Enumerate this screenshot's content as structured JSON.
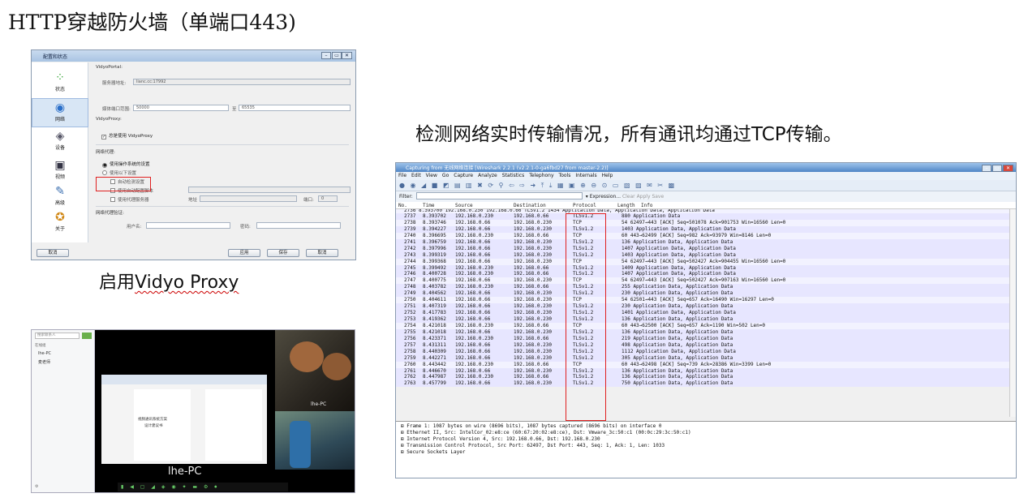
{
  "slide": {
    "title": "HTTP穿越防火墙（单端口443)",
    "caption_right": "检测网络实时传输情况，所有通讯均通过TCP传输。",
    "caption_proxy_prefix": "启用",
    "caption_proxy_word": "Vidyo Proxy"
  },
  "config_window": {
    "title": "配置和状态",
    "sidebar": [
      {
        "label": "状态",
        "icon": "status-icon"
      },
      {
        "label": "网络",
        "icon": "network-icon"
      },
      {
        "label": "设备",
        "icon": "device-icon"
      },
      {
        "label": "视频",
        "icon": "video-icon"
      },
      {
        "label": "高级",
        "icon": "advanced-icon"
      },
      {
        "label": "关于",
        "icon": "about-icon"
      }
    ],
    "vidyoportal_label": "VidyoPortal:",
    "portal_addr_label": "服务器地址:",
    "portal_addr_value": "lianc.cc:17992",
    "media_port_label": "媒体端口范围:",
    "media_port_from": "50000",
    "media_port_to_label": "至",
    "media_port_to": "65535",
    "vidyoproxy_label": "VidyoProxy:",
    "always_proxy": "总是使用 VidyoProxy",
    "web_proxy_label": "网络代理:",
    "use_system": "使用操作系统的设置",
    "use_following": "使用以下设置",
    "auto_detect": "自动检测设置",
    "use_auto_config": "使用自动配置脚本",
    "use_proxy_server": "使用代理服务器",
    "address_label": "地址",
    "port_label": "端口:",
    "port_value": "0",
    "proxy_auth_label": "网络代理验证:",
    "username_label": "用户名:",
    "password_label": "密码:",
    "btn_cancel_left": "取消",
    "btn_apply": "应用",
    "btn_save": "保存",
    "btn_cancel": "取消"
  },
  "wireshark": {
    "title": "Capturing from 无线网络连接  [Wireshark 2.2.1 (v2.2.1-0-ga6fbd27 from master-2.2)]",
    "menu": [
      "File",
      "Edit",
      "View",
      "Go",
      "Capture",
      "Analyze",
      "Statistics",
      "Telephony",
      "Tools",
      "Internals",
      "Help"
    ],
    "toolbar_icons": "● ◉ ◢ ■ ◩ ▤ ▥ ✖ ⟳ ⚲ ⇦ ⇨ ➜ ⤒ ⤓ ▦ ▣ ⊕ ⊖ ⊙ ▭ ▧ ▨ ✉ ✂ ▩",
    "filter_label": "Filter:",
    "filter_expression": "Expression...",
    "filter_clear": "Clear",
    "filter_apply": "Apply",
    "filter_save": "Save",
    "columns": {
      "no": "No.",
      "time": "Time",
      "source": "Source",
      "destination": "Destination",
      "protocol": "Protocol",
      "length": "Length",
      "info": "Info"
    },
    "partial_row": "2736 8.393700  192.168.0.230   192.168.0.66    TLSv1.2       1434 Application Data, Application Data, Application Data",
    "packets": [
      [
        "2737",
        "8.393702",
        "192.168.0.230",
        "192.168.0.66",
        "TLSv1.2",
        "880 Application Data"
      ],
      [
        "2738",
        "8.393746",
        "192.168.0.66",
        "192.168.0.230",
        "TCP",
        "54 62497→443 [ACK] Seq=501078 Ack=901753 Win=16560 Len=0"
      ],
      [
        "2739",
        "8.394227",
        "192.168.0.66",
        "192.168.0.230",
        "TLSv1.2",
        "1403 Application Data, Application Data"
      ],
      [
        "2740",
        "8.396695",
        "192.168.0.230",
        "192.168.0.66",
        "TCP",
        "60 443→62499 [ACK] Seq=982 Ack=93979 Win=8146 Len=0"
      ],
      [
        "2741",
        "8.396759",
        "192.168.0.66",
        "192.168.0.230",
        "TLSv1.2",
        "136 Application Data, Application Data"
      ],
      [
        "2742",
        "8.397996",
        "192.168.0.66",
        "192.168.0.230",
        "TLSv1.2",
        "1407 Application Data, Application Data"
      ],
      [
        "2743",
        "8.399319",
        "192.168.0.66",
        "192.168.0.230",
        "TLSv1.2",
        "1403 Application Data, Application Data"
      ],
      [
        "2744",
        "8.399368",
        "192.168.0.66",
        "192.168.0.230",
        "TCP",
        "54 62497→443 [ACK] Seq=502427 Ack=904455 Win=16560 Len=0"
      ],
      [
        "2745",
        "8.399492",
        "192.168.0.230",
        "192.168.0.66",
        "TLSv1.2",
        "1409 Application Data, Application Data"
      ],
      [
        "2746",
        "8.400728",
        "192.168.0.230",
        "192.168.0.66",
        "TLSv1.2",
        "1407 Application Data, Application Data"
      ],
      [
        "2747",
        "8.400775",
        "192.168.0.66",
        "192.168.0.230",
        "TCP",
        "54 62497→443 [ACK] Seq=502427 Ack=907163 Win=16560 Len=0"
      ],
      [
        "2748",
        "8.403782",
        "192.168.0.230",
        "192.168.0.66",
        "TLSv1.2",
        "255 Application Data, Application Data"
      ],
      [
        "2749",
        "8.404562",
        "192.168.0.66",
        "192.168.0.230",
        "TLSv1.2",
        "230 Application Data, Application Data"
      ],
      [
        "2750",
        "8.404611",
        "192.168.0.66",
        "192.168.0.230",
        "TCP",
        "54 62501→443 [ACK] Seq=657 Ack=16490 Win=16297 Len=0"
      ],
      [
        "2751",
        "8.407319",
        "192.168.0.66",
        "192.168.0.230",
        "TLSv1.2",
        "230 Application Data, Application Data"
      ],
      [
        "2752",
        "8.417783",
        "192.168.0.66",
        "192.168.0.230",
        "TLSv1.2",
        "1401 Application Data, Application Data"
      ],
      [
        "2753",
        "8.419362",
        "192.168.0.66",
        "192.168.0.230",
        "TLSv1.2",
        "136 Application Data, Application Data"
      ],
      [
        "2754",
        "8.421018",
        "192.168.0.230",
        "192.168.0.66",
        "TCP",
        "60 443→62500 [ACK] Seq=657 Ack=1190 Win=502 Len=0"
      ],
      [
        "2755",
        "8.421018",
        "192.168.0.66",
        "192.168.0.230",
        "TLSv1.2",
        "136 Application Data, Application Data"
      ],
      [
        "2756",
        "8.423371",
        "192.168.0.230",
        "192.168.0.66",
        "TLSv1.2",
        "219 Application Data, Application Data"
      ],
      [
        "2757",
        "8.431311",
        "192.168.0.66",
        "192.168.0.230",
        "TLSv1.2",
        "498 Application Data, Application Data"
      ],
      [
        "2758",
        "8.440309",
        "192.168.0.66",
        "192.168.0.230",
        "TLSv1.2",
        "1112 Application Data, Application Data"
      ],
      [
        "2759",
        "8.442271",
        "192.168.0.66",
        "192.168.0.230",
        "TLSv1.2",
        "305 Application Data, Application Data"
      ],
      [
        "2760",
        "8.443442",
        "192.168.0.230",
        "192.168.0.66",
        "TCP",
        "60 443→62498 [ACK] Seq=739 Ack=28386 Win=3399 Len=0"
      ],
      [
        "2761",
        "8.446670",
        "192.168.0.66",
        "192.168.0.230",
        "TLSv1.2",
        "136 Application Data, Application Data"
      ],
      [
        "2762",
        "8.447987",
        "192.168.0.230",
        "192.168.0.66",
        "TLSv1.2",
        "136 Application Data, Application Data"
      ],
      [
        "2763",
        "8.457799",
        "192.168.0.66",
        "192.168.0.230",
        "TLSv1.2",
        "750 Application Data, Application Data"
      ]
    ],
    "details": [
      "⊞ Frame 1: 1087 bytes on wire (8696 bits), 1087 bytes captured (8696 bits) on interface 0",
      "⊞ Ethernet II, Src: IntelCor_02:e8:ce (60:67:20:02:e8:ce), Dst: Vmware_3c:50:c1 (00:0c:29:3c:50:c1)",
      "⊞ Internet Protocol Version 4, Src: 192.168.0.66, Dst: 192.168.0.230",
      "⊞ Transmission Control Protocol, Src Port: 62497, Dst Port: 443, Seq: 1, Ack: 1, Len: 1033",
      "⊞ Secure Sockets Layer"
    ]
  },
  "video_window": {
    "search_placeholder": "搜索联系人",
    "group_label": "在线组",
    "contacts": [
      "lhe-PC",
      "麦老师"
    ],
    "participant_name": "lhe-PC",
    "doc_title": "视频通讯系统方案",
    "doc_subtitle": "设计建议书",
    "cam_label": "lhe-PC",
    "toolbar_icons": "▮ ◀ ▢ ◢ ◈ ◉ ✦ ▬ ⚙ ⏺"
  },
  "colors": {
    "highlight": "#e02020",
    "ws_alt_row": "#e7e6ff"
  }
}
